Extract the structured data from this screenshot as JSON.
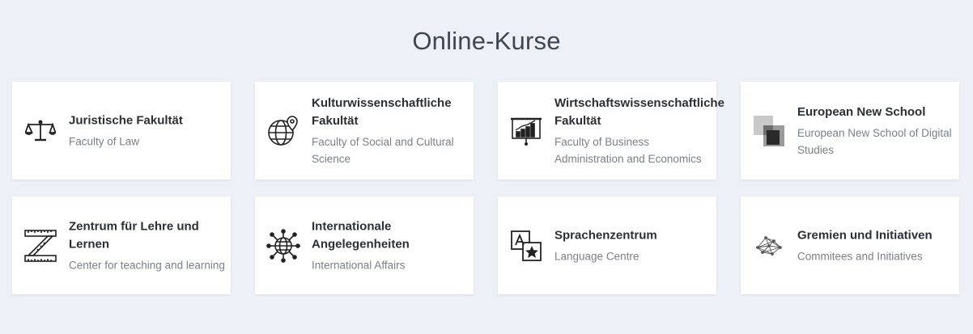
{
  "heading": "Online-Kurse",
  "cards": [
    {
      "title": "Juristische Fakultät",
      "subtitle": "Faculty of Law",
      "icon": "scales-icon"
    },
    {
      "title": "Kulturwissenschaftliche Fakultät",
      "subtitle": "Faculty of Social and Cultural Science",
      "icon": "globe-pin-icon"
    },
    {
      "title": "Wirtschaftswissenschaftliche Fakultät",
      "subtitle": "Faculty of Business Administration and Economics",
      "icon": "presentation-chart-icon"
    },
    {
      "title": "European New School",
      "subtitle": "European New School of Digital Studies",
      "icon": "ens-logo-icon"
    },
    {
      "title": "Zentrum für Lehre und Lernen",
      "subtitle": "Center for teaching and learning",
      "icon": "ruler-z-icon"
    },
    {
      "title": "Internationale Angelegenheiten",
      "subtitle": "International Affairs",
      "icon": "network-globe-icon"
    },
    {
      "title": "Sprachenzentrum",
      "subtitle": "Language Centre",
      "icon": "translate-icon"
    },
    {
      "title": "Gremien und Initiativen",
      "subtitle": "Commitees and Initiatives",
      "icon": "network-nodes-icon"
    }
  ]
}
